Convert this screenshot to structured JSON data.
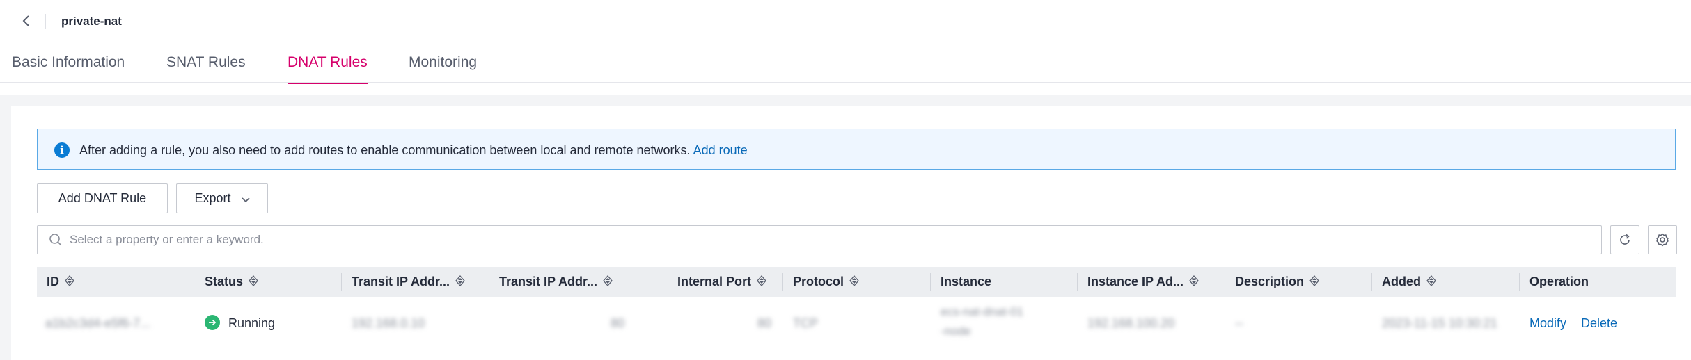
{
  "header": {
    "title": "private-nat"
  },
  "tabs": [
    {
      "label": "Basic Information"
    },
    {
      "label": "SNAT Rules"
    },
    {
      "label": "DNAT Rules",
      "active": true
    },
    {
      "label": "Monitoring"
    }
  ],
  "alert": {
    "text": "After adding a rule, you also need to add routes to enable communication between local and remote networks.",
    "link": "Add route",
    "icon": "info-icon"
  },
  "toolbar": {
    "add_label": "Add DNAT Rule",
    "export_label": "Export"
  },
  "search": {
    "placeholder": "Select a property or enter a keyword."
  },
  "table": {
    "columns": [
      "ID",
      "Status",
      "Transit IP Addr...",
      "Transit IP Addr...",
      "Internal Port",
      "Protocol",
      "Instance",
      "Instance IP Ad...",
      "Description",
      "Added",
      "Operation"
    ],
    "rows": [
      {
        "id": "a1b2c3d4-e5f6-7...",
        "status": "Running",
        "transit_ip": "192.168.0.10",
        "transit_port": "80",
        "internal_port": "80",
        "protocol": "TCP",
        "instance_line1": "ecs-nat-dnat-01",
        "instance_line2": "-node",
        "instance_ip": "192.168.100.20",
        "description": "--",
        "added": "2023-11-15 10:30:21",
        "operations": [
          "Modify",
          "Delete"
        ]
      }
    ]
  },
  "colors": {
    "accent": "#d6006b",
    "link": "#0a6ab8",
    "status_running": "#2bb673",
    "info": "#0a7cd4"
  }
}
